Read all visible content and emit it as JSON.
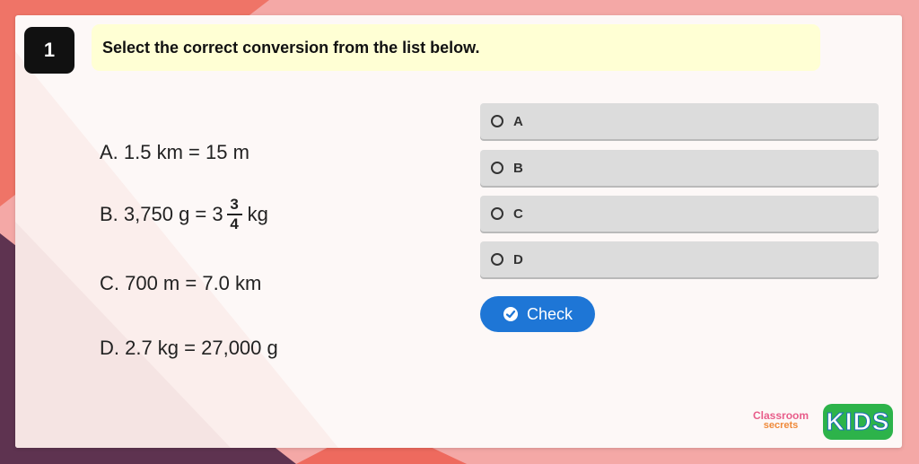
{
  "question": {
    "number": "1",
    "prompt": "Select the correct conversion from the list below."
  },
  "statements": [
    {
      "text": "A. 1.5 km = 15 m"
    },
    {
      "prefix": "B. 3,750 g = 3",
      "frac_num": "3",
      "frac_den": "4",
      "suffix": "kg"
    },
    {
      "text": "C. 700 m = 7.0 km"
    },
    {
      "text": "D. 2.7 kg = 27,000 g"
    }
  ],
  "options": [
    {
      "label": "A"
    },
    {
      "label": "B"
    },
    {
      "label": "C"
    },
    {
      "label": "D"
    }
  ],
  "check_button": {
    "label": "Check",
    "icon": "check-circle-icon"
  },
  "logo": {
    "line1": "Classroom",
    "line2": "secrets",
    "kids": "KIDS"
  },
  "colors": {
    "frame": "#f4a8a6",
    "accent_red": "#ee6a5e",
    "accent_plum": "#5e3350",
    "question_box": "#ffffd4",
    "option_bg": "#dcdcdc",
    "check_button": "#1e76d6",
    "kids_green": "#2db34a"
  }
}
